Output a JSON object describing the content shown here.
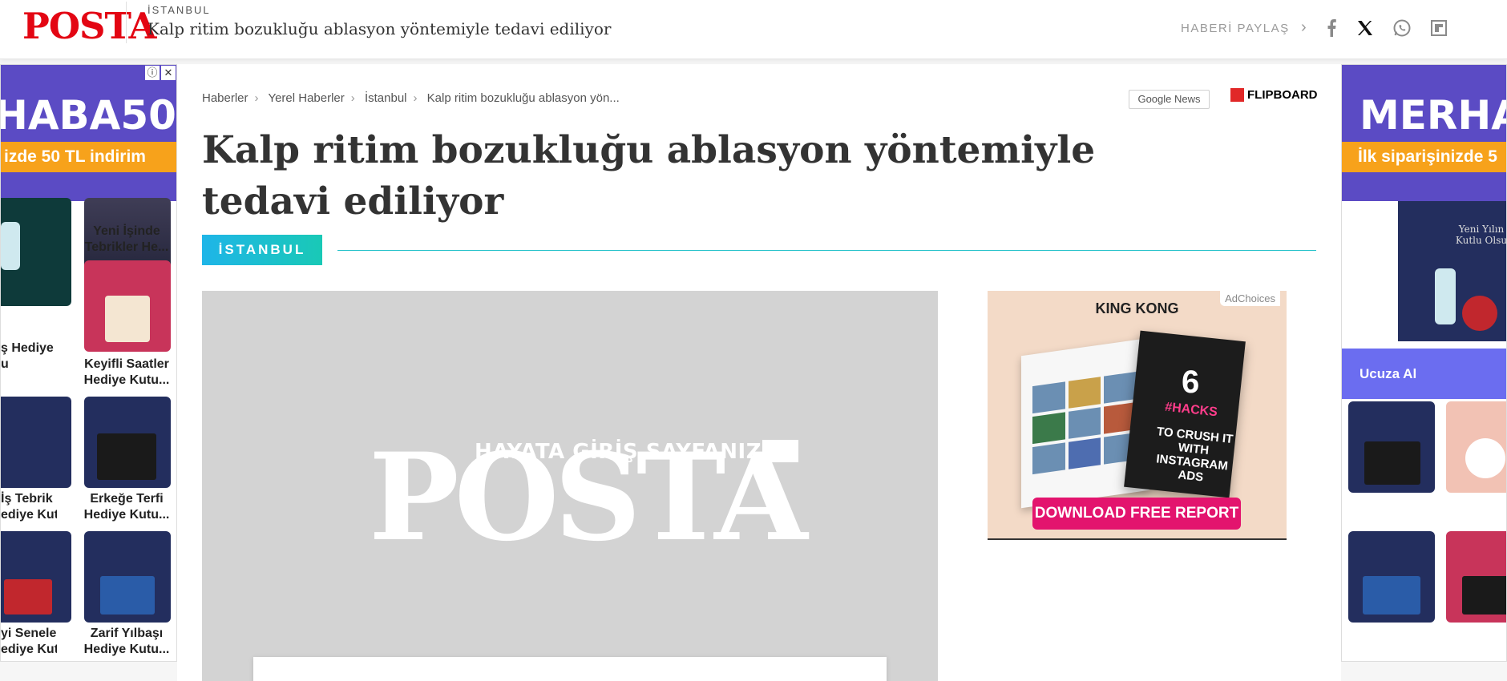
{
  "header": {
    "logo": "POSTA",
    "category": "İSTANBUL",
    "title": "Kalp ritim bozukluğu ablasyon yöntemiyle tedavi ediliyor",
    "share_label": "HABERİ PAYLAŞ",
    "social_icons": [
      "facebook-icon",
      "x-icon",
      "whatsapp-icon",
      "flipboard-icon"
    ]
  },
  "ad_left": {
    "code_text": "HABA50",
    "strip_text": "izde 50 TL indirim",
    "products": [
      {
        "caption1": "Yeni İşinde",
        "caption2": "Tebrikler He..."
      },
      {
        "caption1": "ş Hediye",
        "caption2": "u"
      },
      {
        "caption1": "Keyifli Saatler",
        "caption2": "Hediye Kutu..."
      },
      {
        "caption1": "İş Tebrik",
        "caption2": "ediye Kutu..."
      },
      {
        "caption1": "Erkeğe Terfi",
        "caption2": "Hediye Kutu..."
      },
      {
        "caption1": "yi Seneler",
        "caption2": "ediye Kutu..."
      },
      {
        "caption1": "Zarif Yılbaşı",
        "caption2": "Hediye Kutu..."
      }
    ]
  },
  "breadcrumb": [
    "Haberler",
    "Yerel Haberler",
    "İstanbul",
    "Kalp ritim bozukluğu ablasyon yön..."
  ],
  "google_news": "Google News",
  "flipboard": "FLIPBOARD",
  "article": {
    "title": "Kalp ritim bozukluğu ablasyon yöntemiyle tedavi ediliyor",
    "category_badge": "İSTANBUL",
    "hero_logo": "POSTA",
    "hero_tagline": "HAYATA GİRİŞ SAYFANIZ"
  },
  "ad_middle": {
    "brand": "KING KONG",
    "adchoices": "AdChoices",
    "book_number": "6",
    "book_title": "#HACKS",
    "book_sub": "TO CRUSH IT WITH INSTAGRAM ADS",
    "button": "DOWNLOAD FREE REPORT"
  },
  "ad_right": {
    "code_text": "MERHA",
    "strip_text": "İlk siparişinizde 5",
    "cta": "Ucuza Al",
    "box_text1": "Yeni Yılın",
    "box_text2": "Kutlu Olsu"
  },
  "colors": {
    "brand_red": "#e30613",
    "ad_purple": "#5b4bc4",
    "ad_orange": "#f7a21b",
    "badge_start": "#1fb5e8",
    "badge_end": "#19c9b6"
  }
}
